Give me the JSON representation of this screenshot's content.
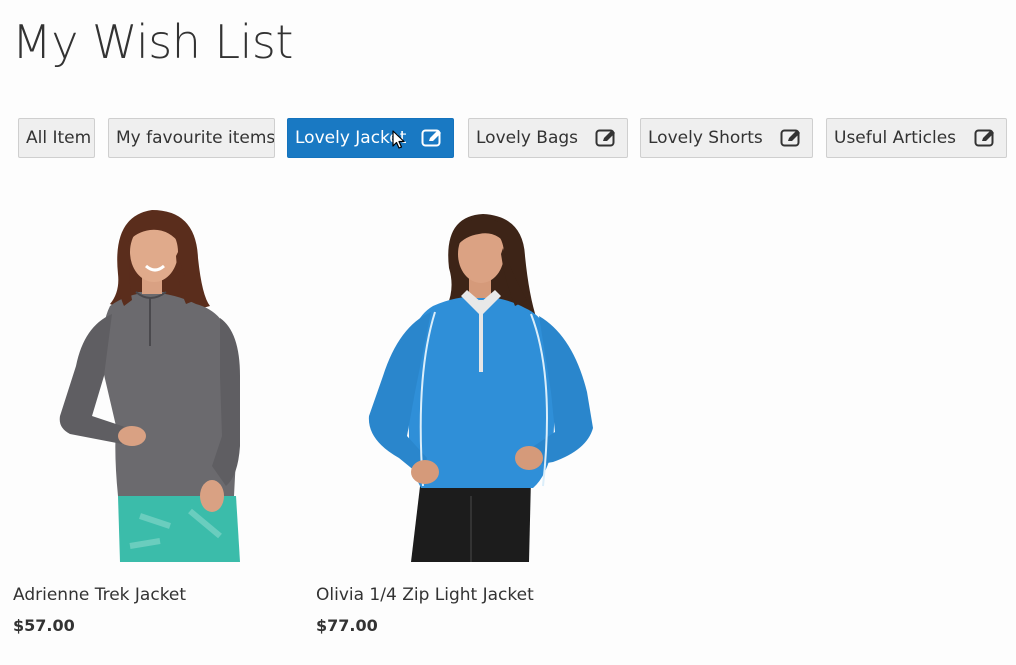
{
  "page": {
    "title": "My Wish List"
  },
  "tabs": [
    {
      "label": "All Item",
      "editable": false,
      "active": false
    },
    {
      "label": "My favourite items",
      "editable": false,
      "active": false
    },
    {
      "label": "Lovely Jacket",
      "editable": true,
      "active": true
    },
    {
      "label": "Lovely Bags",
      "editable": true,
      "active": false
    },
    {
      "label": "Lovely Shorts",
      "editable": true,
      "active": false
    },
    {
      "label": "Useful Articles",
      "editable": true,
      "active": false
    }
  ],
  "products": [
    {
      "name": "Adrienne Trek Jacket",
      "price": "$57.00",
      "jacket_color": "#6b6a6e",
      "bottom_color": "#3bbcaa"
    },
    {
      "name": "Olivia 1/4 Zip Light Jacket",
      "price": "$77.00",
      "jacket_color": "#2f8fd8",
      "bottom_color": "#1c1c1c"
    }
  ],
  "colors": {
    "accent": "#1979c3",
    "tab_bg": "#efefef"
  },
  "icons": {
    "tab_edit": "edit-icon",
    "cursor": "mouse-pointer-icon"
  }
}
